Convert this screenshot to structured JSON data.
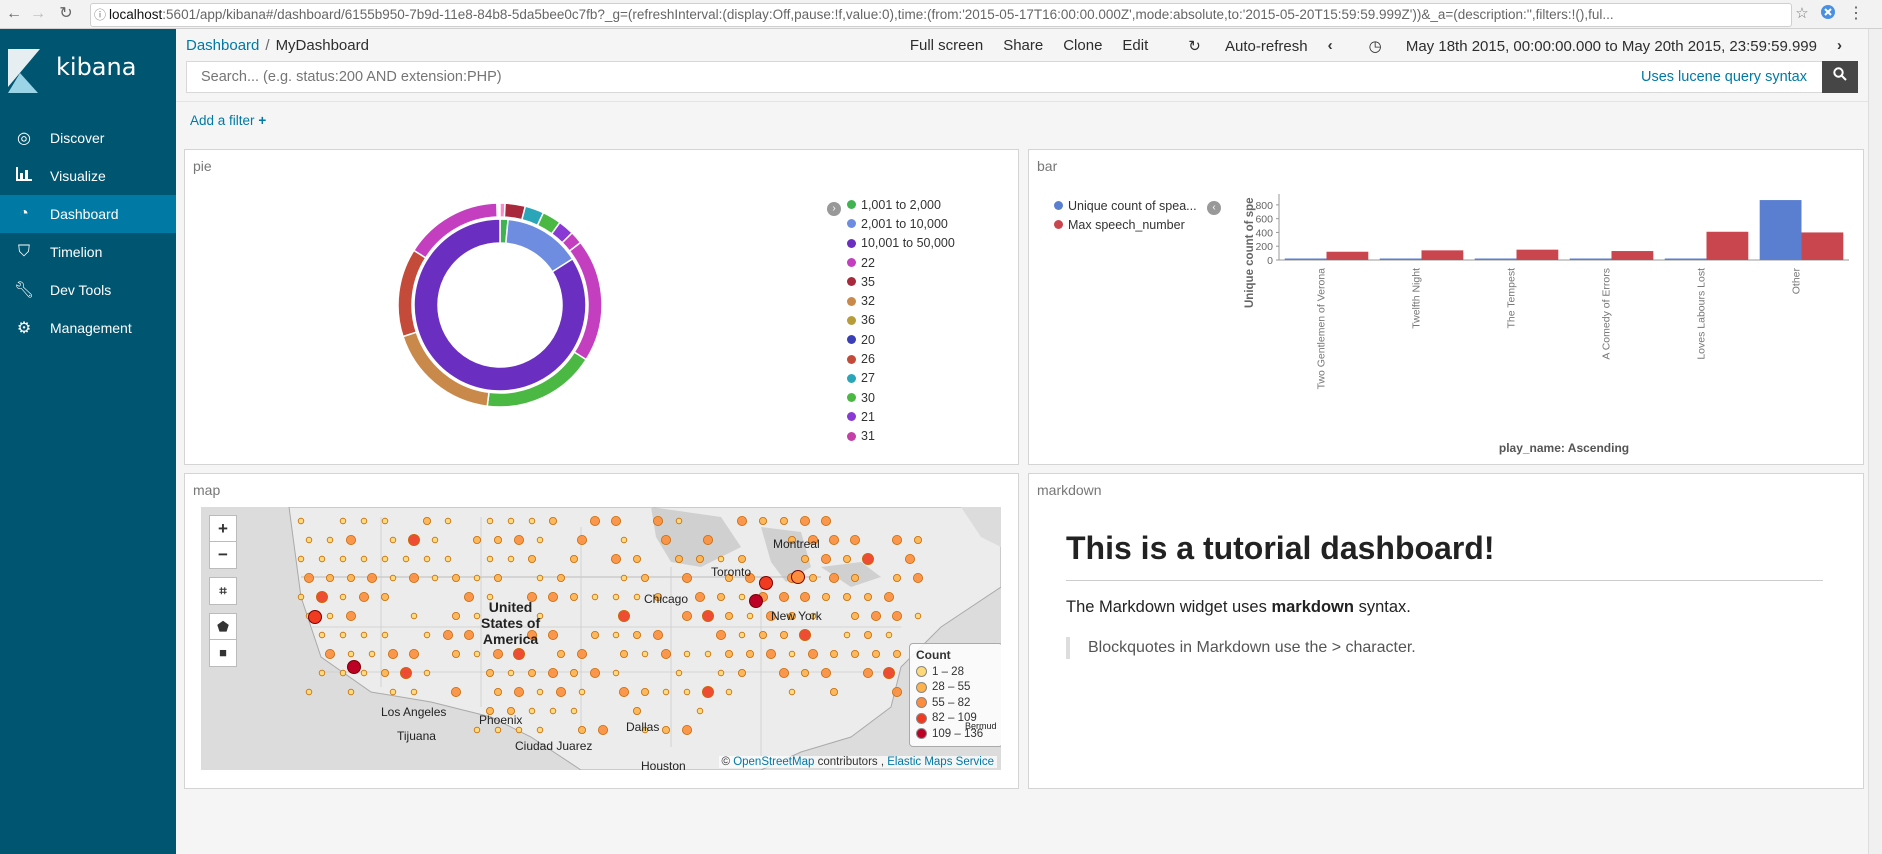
{
  "browser": {
    "url_host": "localhost",
    "url_rest": ":5601/app/kibana#/dashboard/6155b950-7b9d-11e8-84b8-5da5bee0c7fb?_g=(refreshInterval:(display:Off,pause:!f,value:0),time:(from:'2015-05-17T16:00:00.000Z',mode:absolute,to:'2015-05-20T15:59:59.999Z'))&_a=(description:'',filters:!(),ful..."
  },
  "sidebar": {
    "brand": "kibana",
    "items": [
      {
        "label": "Discover",
        "icon": "compass-icon"
      },
      {
        "label": "Visualize",
        "icon": "bar-chart-icon"
      },
      {
        "label": "Dashboard",
        "icon": "dashboard-icon"
      },
      {
        "label": "Timelion",
        "icon": "timelion-icon"
      },
      {
        "label": "Dev Tools",
        "icon": "wrench-icon"
      },
      {
        "label": "Management",
        "icon": "gear-icon"
      }
    ]
  },
  "breadcrumb": {
    "root": "Dashboard",
    "separator": "/",
    "current": "MyDashboard"
  },
  "toolbar": {
    "full_screen": "Full screen",
    "share": "Share",
    "clone": "Clone",
    "edit": "Edit",
    "auto_refresh": "Auto-refresh",
    "time_range": "May 18th 2015, 00:00:00.000 to May 20th 2015, 23:59:59.999"
  },
  "search": {
    "placeholder": "Search... (e.g. status:200 AND extension:PHP)",
    "syntax_link": "Uses lucene query syntax"
  },
  "filters": {
    "add_label": "Add a filter"
  },
  "panels": {
    "pie": {
      "title": "pie"
    },
    "bar": {
      "title": "bar"
    },
    "map": {
      "title": "map"
    },
    "markdown": {
      "title": "markdown"
    }
  },
  "pie_legend": [
    {
      "label": "1,001 to 2,000",
      "color": "#3fb34f"
    },
    {
      "label": "2,001 to 10,000",
      "color": "#6e8ce0"
    },
    {
      "label": "10,001 to 50,000",
      "color": "#6a2fc0"
    },
    {
      "label": "22",
      "color": "#c43fc0"
    },
    {
      "label": "35",
      "color": "#a8293c"
    },
    {
      "label": "32",
      "color": "#c9894a"
    },
    {
      "label": "36",
      "color": "#b89c3a"
    },
    {
      "label": "20",
      "color": "#3a3fb8"
    },
    {
      "label": "26",
      "color": "#c44a3a"
    },
    {
      "label": "27",
      "color": "#2aa6b8"
    },
    {
      "label": "30",
      "color": "#4bb843"
    },
    {
      "label": "21",
      "color": "#8a3ad4"
    },
    {
      "label": "31",
      "color": "#c43fa8"
    }
  ],
  "chart_data": {
    "type": "bar",
    "categories": [
      "Two Gentlemen of Verona",
      "Twelfth Night",
      "The Tempest",
      "A Comedy of Errors",
      "Loves Labours Lost",
      "Other"
    ],
    "series": [
      {
        "name": "Unique count of spea...",
        "color": "#5a7fd0",
        "values": [
          8,
          12,
          15,
          14,
          20,
          870
        ]
      },
      {
        "name": "Max speech_number",
        "color": "#c9464f",
        "values": [
          120,
          140,
          150,
          130,
          410,
          400
        ]
      }
    ],
    "ylabel": "Unique count of spe",
    "xlabel": "play_name: Ascending",
    "yticks": [
      "800",
      "600",
      "400",
      "200",
      "0"
    ],
    "ylim": [
      0,
      900
    ]
  },
  "map": {
    "zoom_in": "+",
    "zoom_out": "−",
    "country": [
      "United",
      "States of",
      "America"
    ],
    "cities": [
      "Montreal",
      "Toronto",
      "Chicago",
      "New York",
      "Los Angeles",
      "Phoenix",
      "Tijuana",
      "Ciudad Juarez",
      "Dallas",
      "Houston",
      "Bermud"
    ],
    "legend_title": "Count",
    "legend": [
      {
        "label": "1 – 28",
        "color": "#fed976"
      },
      {
        "label": "28 – 55",
        "color": "#feb24c"
      },
      {
        "label": "55 – 82",
        "color": "#fd8d3c"
      },
      {
        "label": "82 – 109",
        "color": "#f03b20"
      },
      {
        "label": "109 – 136",
        "color": "#bd0026"
      }
    ],
    "attribution": {
      "copy": "©",
      "osm": "OpenStreetMap",
      "contrib": "contributors ,",
      "ems": "Elastic Maps Service"
    }
  },
  "markdown": {
    "heading": "This is a tutorial dashboard!",
    "p_before": "The Markdown widget uses",
    "p_bold": "markdown",
    "p_after": "syntax.",
    "quote": "Blockquotes in Markdown use the > character."
  }
}
